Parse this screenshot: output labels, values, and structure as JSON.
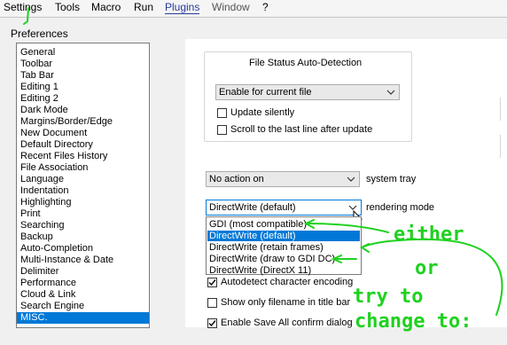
{
  "menubar": {
    "items": [
      "Settings",
      "Tools",
      "Macro",
      "Run",
      "Plugins",
      "Window",
      "?"
    ]
  },
  "dialog": {
    "title": "Preferences"
  },
  "categories": {
    "items": [
      "General",
      "Toolbar",
      "Tab Bar",
      "Editing 1",
      "Editing 2",
      "Dark Mode",
      "Margins/Border/Edge",
      "New Document",
      "Default Directory",
      "Recent Files History",
      "File Association",
      "Language",
      "Indentation",
      "Highlighting",
      "Print",
      "Searching",
      "Backup",
      "Auto-Completion",
      "Multi-Instance & Date",
      "Delimiter",
      "Performance",
      "Cloud & Link",
      "Search Engine",
      "MISC."
    ],
    "selected": "MISC."
  },
  "file_status": {
    "caption": "File Status Auto-Detection",
    "combo_value": "Enable for current file",
    "update_silently": "Update silently",
    "scroll_last_line": "Scroll to the last line after update"
  },
  "system_tray": {
    "value": "No action on",
    "label": "system tray"
  },
  "rendering_mode": {
    "value": "DirectWrite (default)",
    "label": "rendering mode",
    "options": [
      "GDI (most compatible)",
      "DirectWrite (default)",
      "DirectWrite (retain frames)",
      "DirectWrite (draw to GDI DC)",
      "DirectWrite (DirectX 11)"
    ],
    "highlighted": "DirectWrite (default)"
  },
  "checkboxes": {
    "autodetect_encoding": "Autodetect character encoding",
    "filename_title_bar": "Show only filename in title bar",
    "save_all_confirm": "Enable Save All confirm dialog"
  },
  "annotations": {
    "either": "either",
    "or": "or",
    "try_to": "try to",
    "change_to": "change to:",
    "color": "#1fd11f"
  }
}
